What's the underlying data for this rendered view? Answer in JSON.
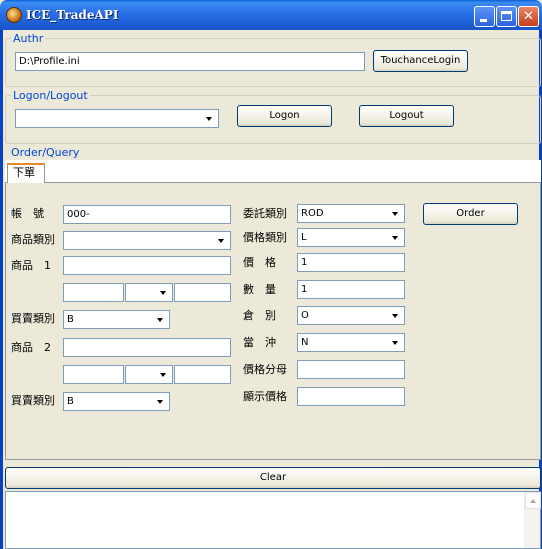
{
  "window": {
    "title": "ICE_TradeAPI"
  },
  "authr": {
    "legend": "Authr",
    "path_value": "D:\\Profile.ini",
    "login_button": "TouchanceLogin"
  },
  "logon": {
    "legend": "Logon/Logout",
    "combo_value": "",
    "logon_button": "Logon",
    "logout_button": "Logout"
  },
  "order": {
    "legend": "Order/Query",
    "tab_label": "下單",
    "left": {
      "account_label": "帳　號",
      "account_value": "000-",
      "product_type_label": "商品類別",
      "product_type_value": "",
      "product1_label": "商品　1",
      "product1_value": "",
      "product1_sub1": "",
      "product1_combo": "",
      "product1_sub2": "",
      "buysell1_label": "買賣類別",
      "buysell1_value": "B",
      "product2_label": "商品　2",
      "product2_value": "",
      "product2_sub1": "",
      "product2_combo": "",
      "product2_sub2": "",
      "buysell2_label": "買賣類別",
      "buysell2_value": "B"
    },
    "right": {
      "order_type_label": "委託類別",
      "order_type_value": "ROD",
      "price_type_label": "價格類別",
      "price_type_value": "L",
      "price_label": "價　格",
      "price_value": "1",
      "qty_label": "數　量",
      "qty_value": "1",
      "position_label": "倉　別",
      "position_value": "O",
      "daytrade_label": "當　沖",
      "daytrade_value": "N",
      "denom_label": "價格分母",
      "denom_value": "",
      "display_price_label": "顯示價格",
      "display_price_value": ""
    },
    "order_button": "Order"
  },
  "clear_button": "Clear",
  "log": {
    "content": ""
  },
  "icons": {
    "app": "ice-app-icon",
    "minimize": "minimize-icon",
    "maximize": "maximize-icon",
    "close": "close-icon"
  },
  "colors": {
    "titlebar": "#2a6fe6",
    "legend": "#0046d5",
    "window_bg": "#ece9d8",
    "tab_accent": "#e68b2c"
  }
}
